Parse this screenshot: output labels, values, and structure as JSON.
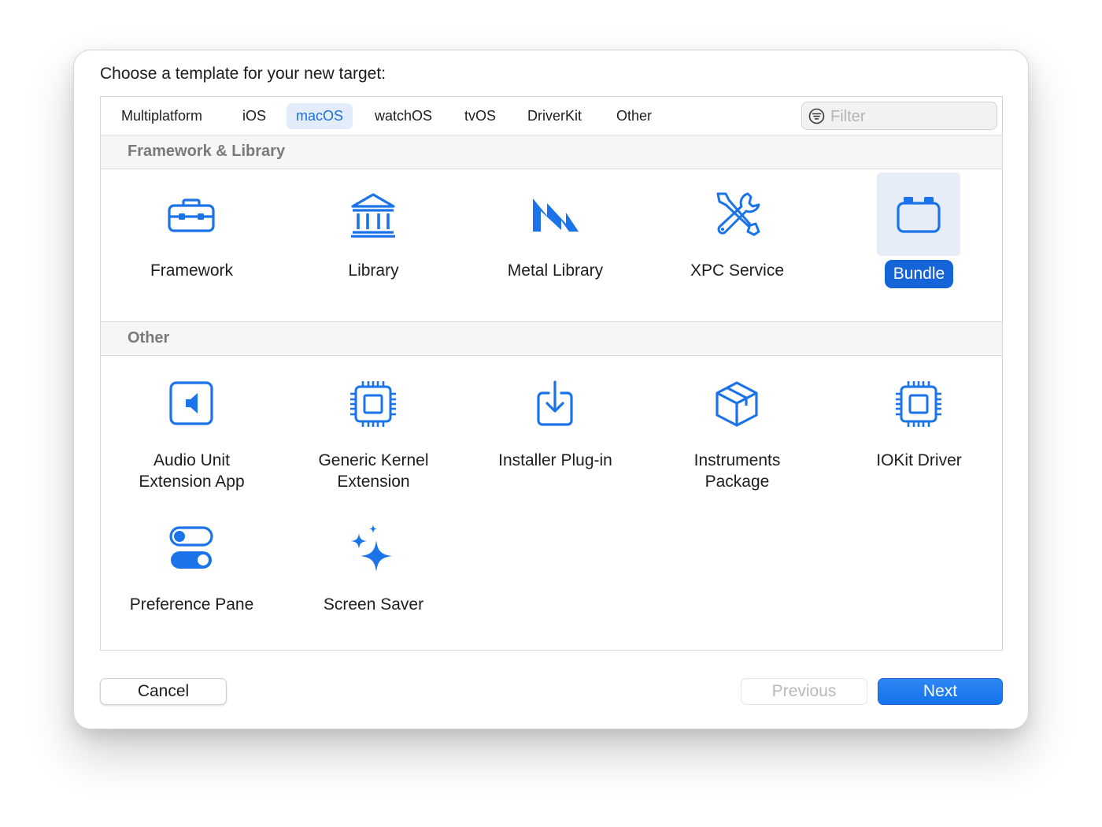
{
  "dialog": {
    "prompt": "Choose a template for your new target:"
  },
  "tabs": [
    {
      "label": "Multiplatform",
      "active": false
    },
    {
      "label": "iOS",
      "active": false
    },
    {
      "label": "macOS",
      "active": true
    },
    {
      "label": "watchOS",
      "active": false
    },
    {
      "label": "tvOS",
      "active": false
    },
    {
      "label": "DriverKit",
      "active": false
    },
    {
      "label": "Other",
      "active": false
    }
  ],
  "filter": {
    "placeholder": "Filter",
    "value": "",
    "icon": "filter-icon"
  },
  "sections": [
    {
      "title": "Framework & Library",
      "items": [
        {
          "label": "Framework",
          "icon": "toolbox-icon"
        },
        {
          "label": "Library",
          "icon": "building-columns-icon"
        },
        {
          "label": "Metal Library",
          "icon": "metal-icon"
        },
        {
          "label": "XPC Service",
          "icon": "wrench-screwdriver-icon"
        },
        {
          "label": "Bundle",
          "icon": "bundle-icon",
          "selected": true
        }
      ]
    },
    {
      "title": "Other",
      "items": [
        {
          "label": "Audio Unit",
          "label2": "Extension App",
          "icon": "speaker-icon"
        },
        {
          "label": "Generic Kernel",
          "label2": "Extension",
          "icon": "cpu-icon"
        },
        {
          "label": "Installer Plug-in",
          "icon": "tray-download-icon"
        },
        {
          "label": "Instruments",
          "label2": "Package",
          "icon": "shipping-box-icon"
        },
        {
          "label": "IOKit Driver",
          "icon": "cpu-icon"
        },
        {
          "label": "Preference Pane",
          "icon": "toggles-icon"
        },
        {
          "label": "Screen Saver",
          "icon": "sparkles-icon"
        }
      ]
    }
  ],
  "buttons": {
    "cancel": "Cancel",
    "previous": "Previous",
    "next": "Next"
  },
  "colors": {
    "accent": "#1565d8",
    "icon_blue": "#1a73e8",
    "tab_active_bg": "#e2ecfa",
    "section_header_text": "#7a7a7a"
  }
}
